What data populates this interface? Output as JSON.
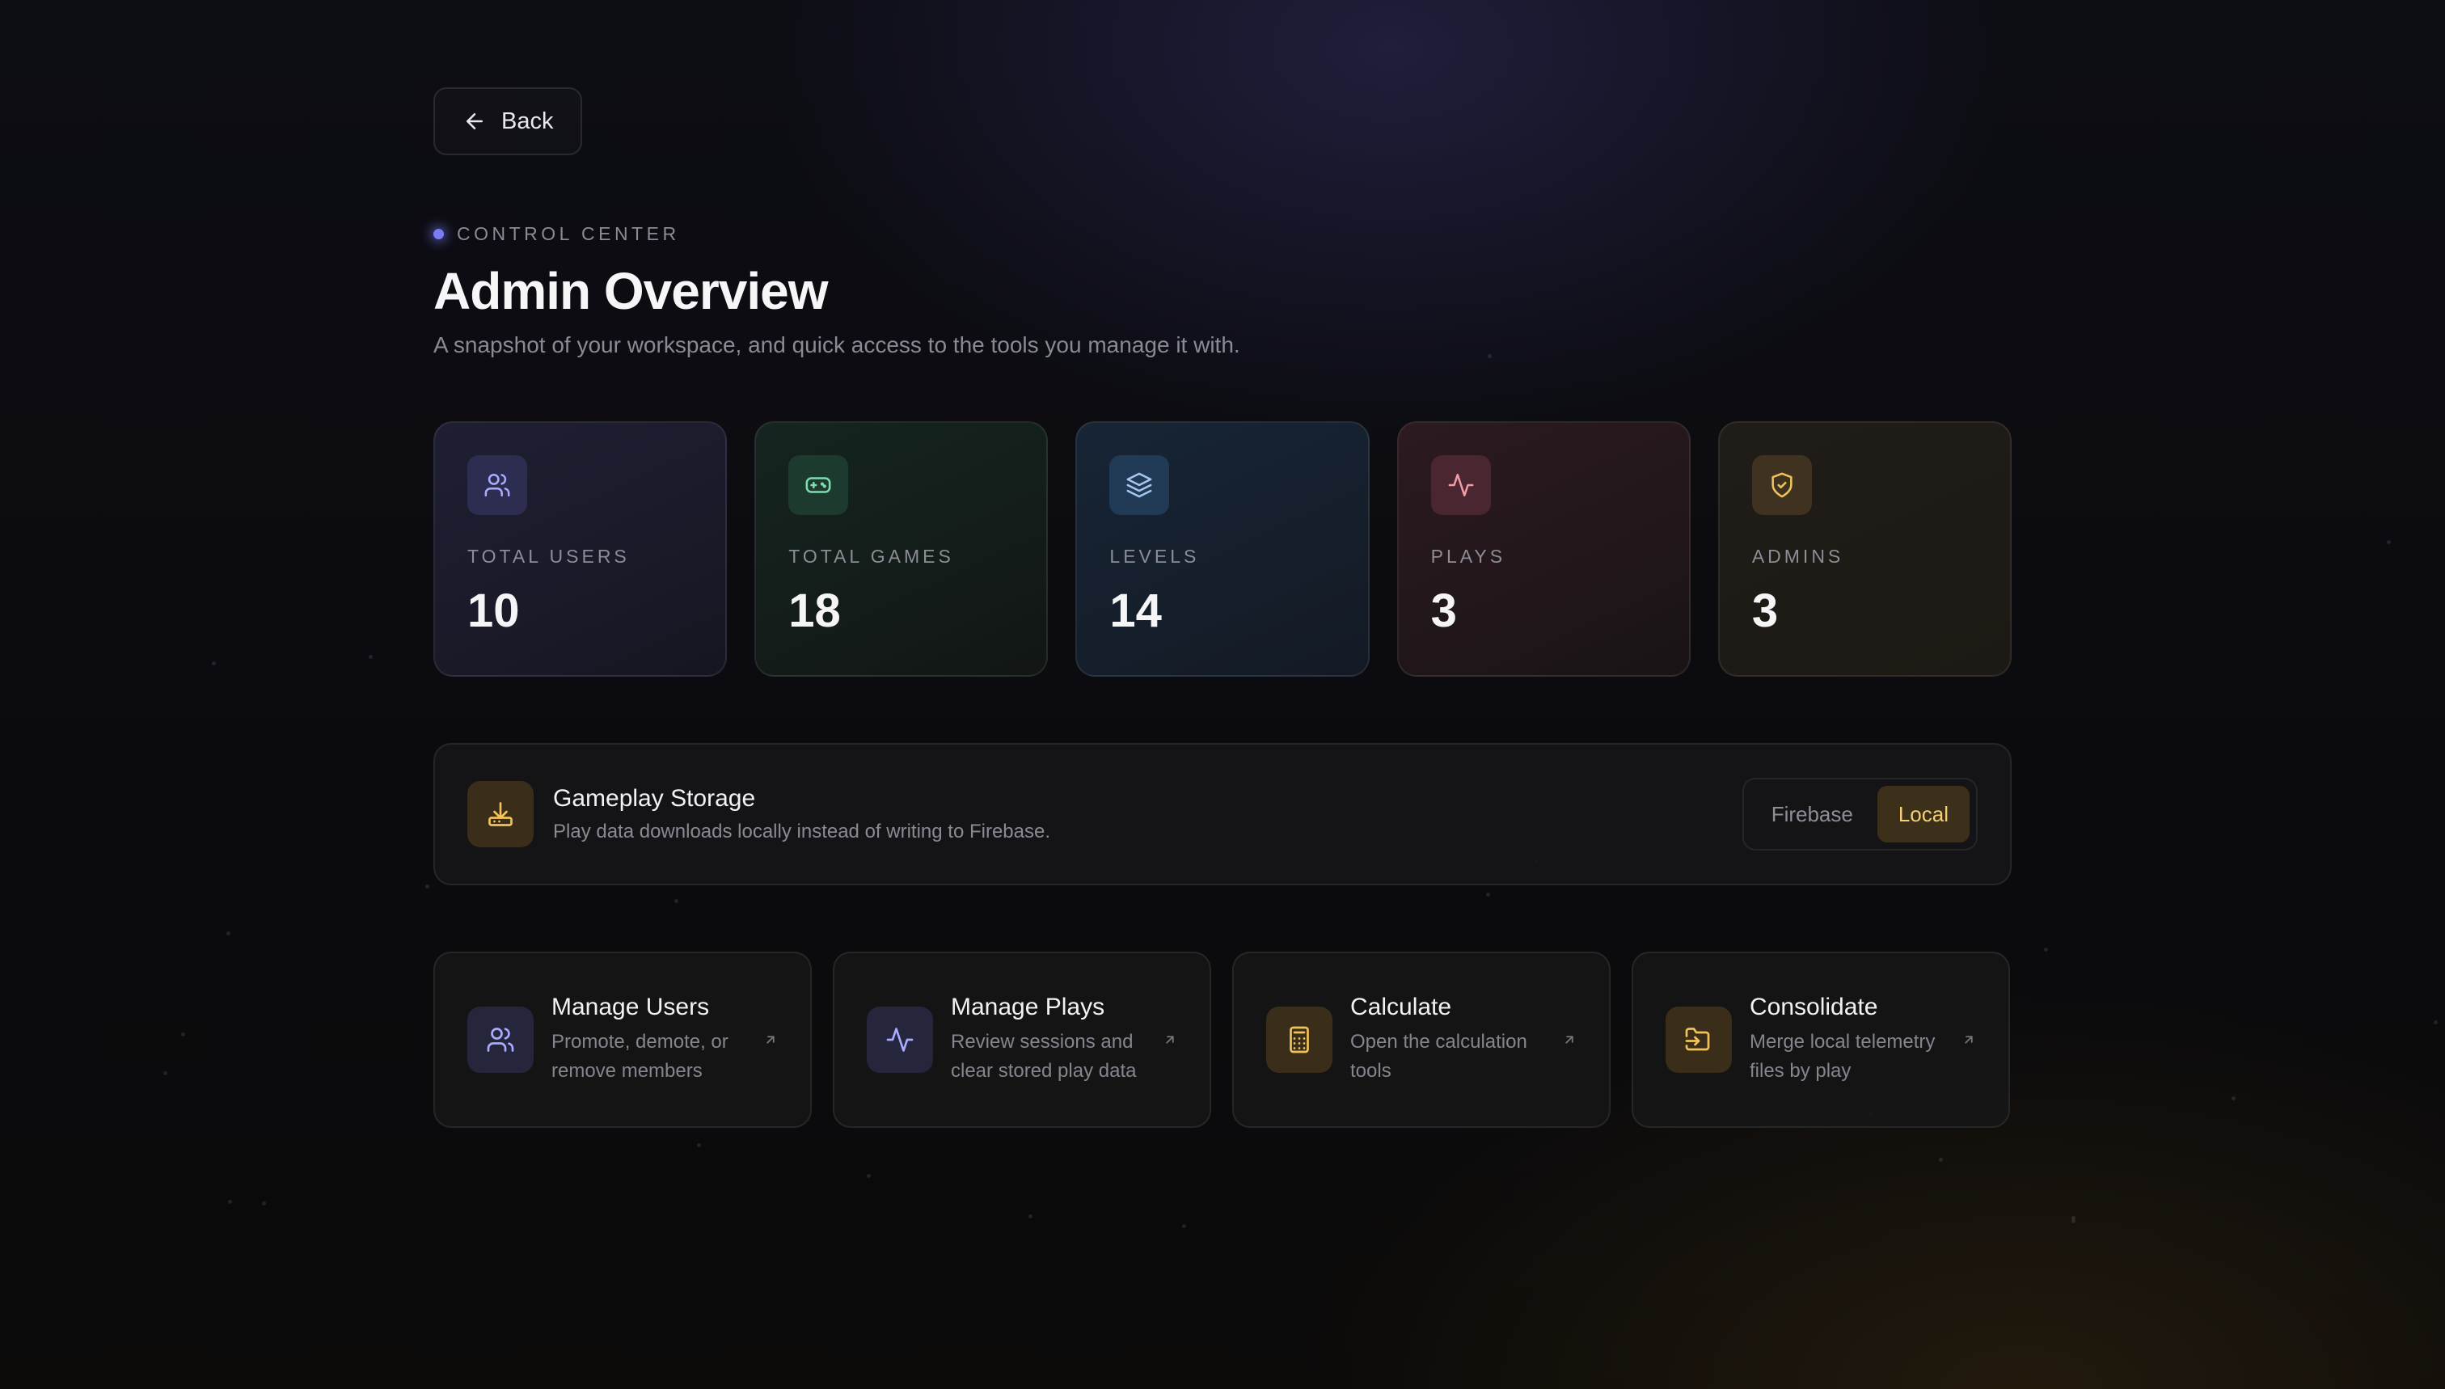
{
  "header": {
    "back_label": "Back",
    "eyebrow": "CONTROL CENTER",
    "title": "Admin Overview",
    "subtitle": "A snapshot of your workspace, and quick access to the tools you manage it with."
  },
  "stats": [
    {
      "label": "TOTAL USERS",
      "value": "10",
      "icon": "users-icon",
      "accent": "#a8abff"
    },
    {
      "label": "TOTAL GAMES",
      "value": "18",
      "icon": "gamepad-icon",
      "accent": "#7fdbb0"
    },
    {
      "label": "LEVELS",
      "value": "14",
      "icon": "layers-icon",
      "accent": "#a5c7ef"
    },
    {
      "label": "PLAYS",
      "value": "3",
      "icon": "activity-icon",
      "accent": "#f29aa6"
    },
    {
      "label": "ADMINS",
      "value": "3",
      "icon": "shield-check-icon",
      "accent": "#f0c35a"
    }
  ],
  "storage": {
    "title": "Gameplay Storage",
    "description": "Play data downloads locally instead of writing to Firebase.",
    "icon": "download-icon",
    "options": [
      "Firebase",
      "Local"
    ],
    "selected": "Local"
  },
  "actions": [
    {
      "title": "Manage Users",
      "description": "Promote, demote, or remove members",
      "icon": "users-icon"
    },
    {
      "title": "Manage Plays",
      "description": "Review sessions and clear stored play data",
      "icon": "activity-icon"
    },
    {
      "title": "Calculate",
      "description": "Open the calculation tools",
      "icon": "calculator-icon"
    },
    {
      "title": "Consolidate",
      "description": "Merge local telemetry files by play",
      "icon": "folder-input-icon"
    }
  ]
}
